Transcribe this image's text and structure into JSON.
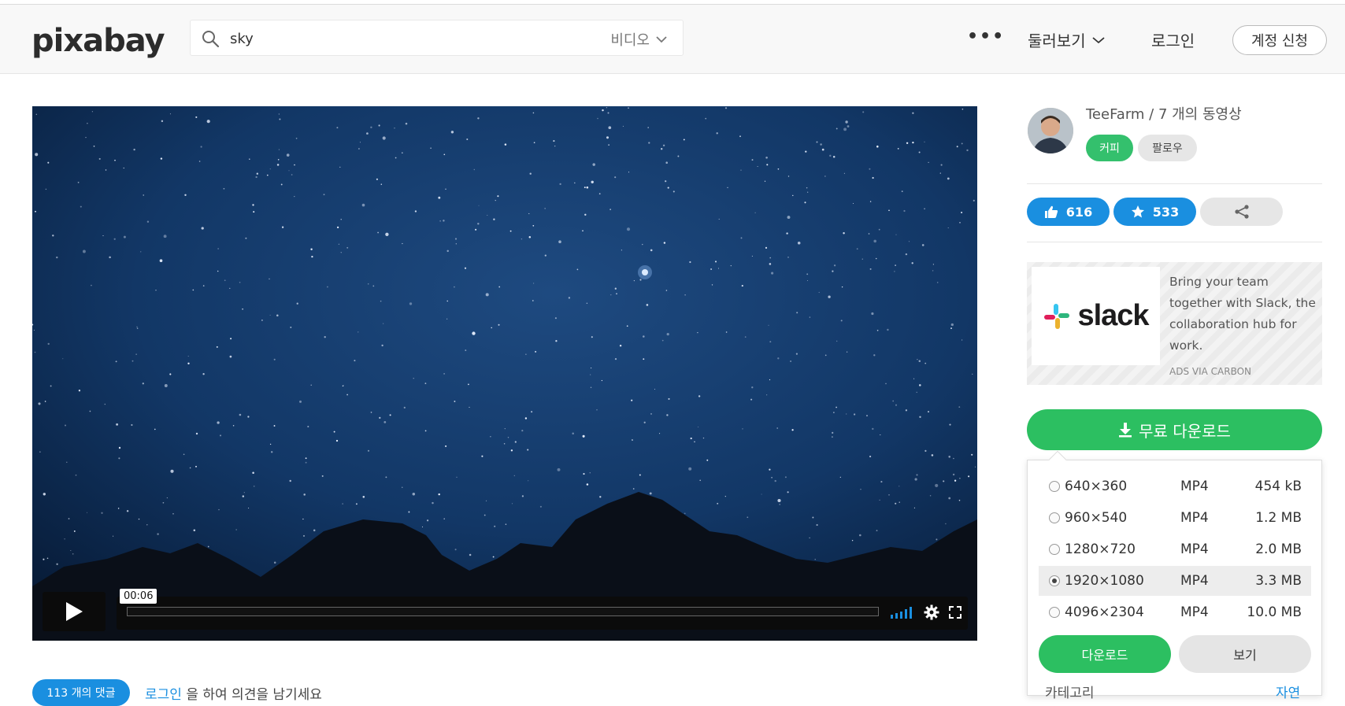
{
  "header": {
    "logo": "pixabay",
    "search_value": "sky",
    "search_type": "비디오",
    "more": "•••",
    "browse": "둘러보기",
    "login": "로그인",
    "signup": "계정 신청"
  },
  "video": {
    "time": "00:06"
  },
  "comments": {
    "count_badge": "113 개의 댓글",
    "login_link": "로그인",
    "prompt": " 을 하여 의견을 남기세요"
  },
  "sidebar": {
    "author": "TeeFarm / 7 개의 동영상",
    "coffee": "커피",
    "follow": "팔로우",
    "likes": "616",
    "favorites": "533",
    "ad": {
      "brand": "slack",
      "text": "Bring your team together with Slack, the collaboration hub for work.",
      "via": "ADS VIA CARBON"
    },
    "download_main": "무료 다운로드",
    "options": [
      {
        "res": "640×360",
        "fmt": "MP4",
        "size": "454 kB",
        "selected": false
      },
      {
        "res": "960×540",
        "fmt": "MP4",
        "size": "1.2 MB",
        "selected": false
      },
      {
        "res": "1280×720",
        "fmt": "MP4",
        "size": "2.0 MB",
        "selected": false
      },
      {
        "res": "1920×1080",
        "fmt": "MP4",
        "size": "3.3 MB",
        "selected": true
      },
      {
        "res": "4096×2304",
        "fmt": "MP4",
        "size": "10.0 MB",
        "selected": false
      }
    ],
    "download_btn": "다운로드",
    "view_btn": "보기",
    "category_label": "카테고리",
    "category_value": "자연"
  },
  "colors": {
    "green": "#2cbf61",
    "blue": "#1a8fe0",
    "sky": "#0c2a52"
  }
}
